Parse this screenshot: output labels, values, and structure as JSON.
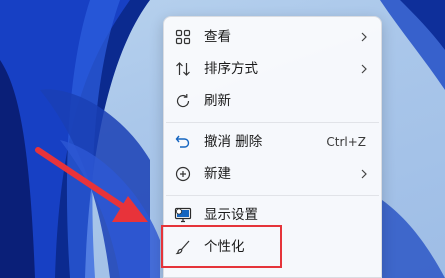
{
  "menu": {
    "items": [
      {
        "label": "查看",
        "icon": "grid-view-icon",
        "has_submenu": true
      },
      {
        "label": "排序方式",
        "icon": "sort-arrows-icon",
        "has_submenu": true
      },
      {
        "label": "刷新",
        "icon": "refresh-icon",
        "has_submenu": false
      },
      {
        "label": "撤消 删除",
        "icon": "undo-icon",
        "shortcut": "Ctrl+Z"
      },
      {
        "label": "新建",
        "icon": "new-plus-icon",
        "has_submenu": true
      },
      {
        "label": "显示设置",
        "icon": "display-settings-icon"
      },
      {
        "label": "个性化",
        "icon": "personalize-brush-icon",
        "highlighted": true
      }
    ]
  },
  "colors": {
    "highlight_border": "#e5343a",
    "arrow_red": "#e8333a",
    "icon_blue": "#1565c0"
  }
}
